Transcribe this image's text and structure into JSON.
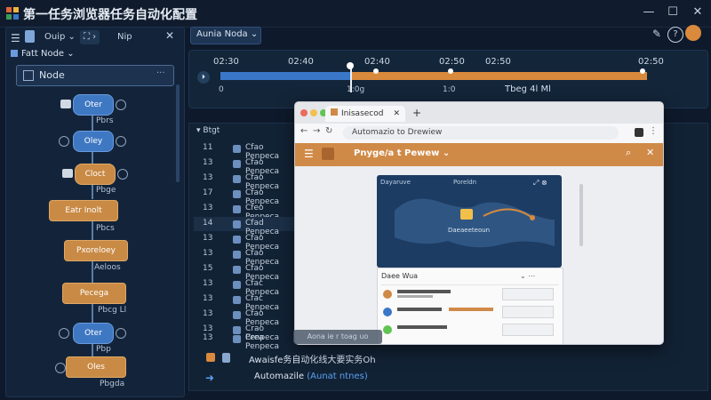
{
  "window": {
    "title": "第一任务浏览器任务自动化配置",
    "controls": [
      "—",
      "☐",
      "✕"
    ]
  },
  "left": {
    "toolbar": {
      "item1": "Ouip ⌄",
      "item2": "Nip"
    },
    "section": "Fatt Node ⌄",
    "node_box": "Node",
    "flow": [
      {
        "label": "Oter",
        "caption": "Pbrs"
      },
      {
        "label": "Oley",
        "caption": ""
      },
      {
        "label": "Cloct",
        "caption": "Pbge"
      },
      {
        "label": "Eatr Inolt",
        "caption": "Pbcs"
      },
      {
        "label": "Pxoreloey",
        "caption": "Aeloos"
      },
      {
        "label": "Pecega",
        "caption": "Pbcg Ll"
      },
      {
        "label": "Oter",
        "caption": "Pbp"
      },
      {
        "label": "Oles",
        "caption": "Pbgda"
      }
    ]
  },
  "topbar": {
    "dropdown": "Aunia Noda ⌄"
  },
  "timeline": {
    "ticks": [
      "02:30",
      "02:40",
      "02:40",
      "02:50",
      "02:50",
      "02:50"
    ],
    "markers": [
      "0",
      "1:0g",
      "1:0"
    ],
    "timestamp": "Tbeg 4l Ml"
  },
  "list": {
    "header": "Btgt",
    "rows": [
      {
        "num": "11",
        "text": "Cfao Penpeca"
      },
      {
        "num": "13",
        "text": "Cfao Penpeca"
      },
      {
        "num": "13",
        "text": "Cfao Penpeca"
      },
      {
        "num": "17",
        "text": "Cfao Penpeca"
      },
      {
        "num": "13",
        "text": "Cfeo Penpeca"
      },
      {
        "num": "14",
        "text": "Cfad Penpeca"
      },
      {
        "num": "13",
        "text": "Cfao Penpeca"
      },
      {
        "num": "13",
        "text": "Cfao Penpeca"
      },
      {
        "num": "15",
        "text": "Cfao Penpeca"
      },
      {
        "num": "13",
        "text": "Cfac Penpeca"
      },
      {
        "num": "13",
        "text": "Cfac Penpeca"
      },
      {
        "num": "13",
        "text": "Cfao Penpeca"
      },
      {
        "num": "13",
        "text": "Crao Penpeca"
      },
      {
        "num": "13",
        "text": "Crea Penpeca"
      }
    ],
    "bottom1": "Awaisfe务自动化线大要实务Oh",
    "bottom2": "Automazile",
    "bottom2_suffix": "(Aunat ntnes)"
  },
  "browser": {
    "tab": "Inisasecod",
    "url": "Automazio to Drewiew",
    "app_title": "Pnyge/a t Pewew ⌄",
    "map_left": "Dayaruve",
    "map_right": "Poreldn",
    "map_label": "Daeaeeteoun",
    "panel_title": "Daee  Wua",
    "toast": "Aona ie r toag uo"
  },
  "colors": {
    "accent": "#d98a3c",
    "primary": "#3b77c8",
    "bg": "#0e1a2b"
  }
}
